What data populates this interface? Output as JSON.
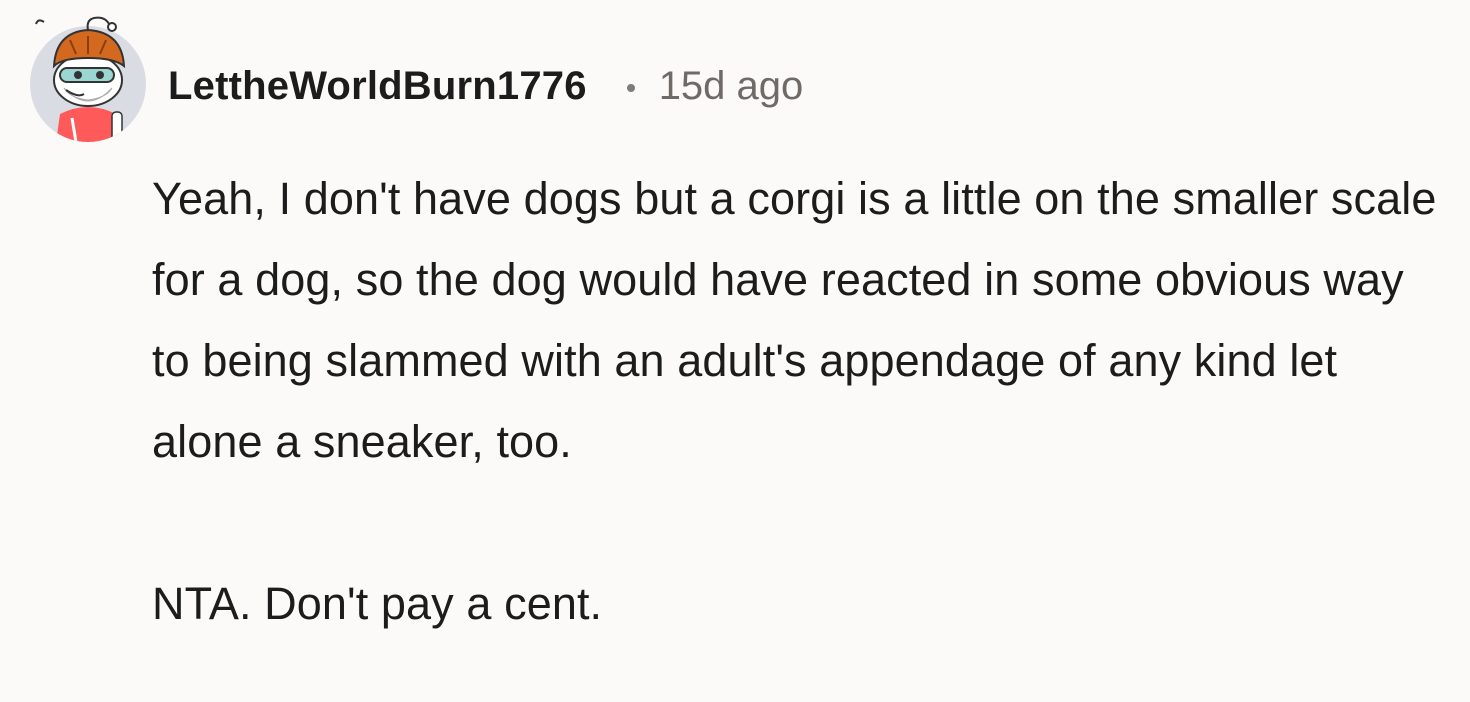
{
  "comment": {
    "username": "LettheWorldBurn1776",
    "separator": "•",
    "timestamp": "15d ago",
    "avatar_icon": "snoo-avatar-icon",
    "paragraphs": [
      "Yeah, I don't have dogs but a corgi is a little on the smaller scale for a dog, so the dog would have reacted in some obvious way to being slammed with an adult's appendage of any kind let alone a sneaker, too.",
      "NTA. Don't pay a cent."
    ]
  },
  "colors": {
    "background": "#fbfaf9",
    "text": "#1c1c1c",
    "meta": "#6f6a66",
    "avatar_circle": "#d9dde3",
    "avatar_hair": "#d2691e",
    "avatar_shirt": "#ff5a5a"
  }
}
